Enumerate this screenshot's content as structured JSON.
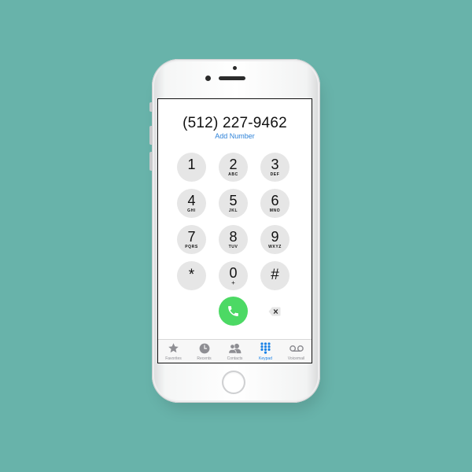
{
  "dialer": {
    "phone_number": "(512) 227-9462",
    "add_number": "Add Number"
  },
  "keypad": {
    "keys": [
      {
        "digit": "1",
        "letters": ""
      },
      {
        "digit": "2",
        "letters": "ABC"
      },
      {
        "digit": "3",
        "letters": "DEF"
      },
      {
        "digit": "4",
        "letters": "GHI"
      },
      {
        "digit": "5",
        "letters": "JKL"
      },
      {
        "digit": "6",
        "letters": "MNO"
      },
      {
        "digit": "7",
        "letters": "PQRS"
      },
      {
        "digit": "8",
        "letters": "TUV"
      },
      {
        "digit": "9",
        "letters": "WXYZ"
      },
      {
        "digit": "*",
        "letters": ""
      },
      {
        "digit": "0",
        "letters": "+"
      },
      {
        "digit": "#",
        "letters": ""
      }
    ]
  },
  "actions": {
    "call_icon": "phone-icon",
    "delete_icon": "delete-backspace-icon"
  },
  "tabbar": {
    "tabs": [
      {
        "label": "Favorites",
        "icon": "star-icon",
        "active": false
      },
      {
        "label": "Recents",
        "icon": "clock-icon",
        "active": false
      },
      {
        "label": "Contacts",
        "icon": "contacts-icon",
        "active": false
      },
      {
        "label": "Keypad",
        "icon": "keypad-icon",
        "active": true
      },
      {
        "label": "Voicemail",
        "icon": "voicemail-icon",
        "active": false
      }
    ]
  },
  "colors": {
    "background": "#68b3aa",
    "accent": "#1a82e6",
    "call_green": "#4cd964",
    "key_gray": "#e6e6e6"
  }
}
